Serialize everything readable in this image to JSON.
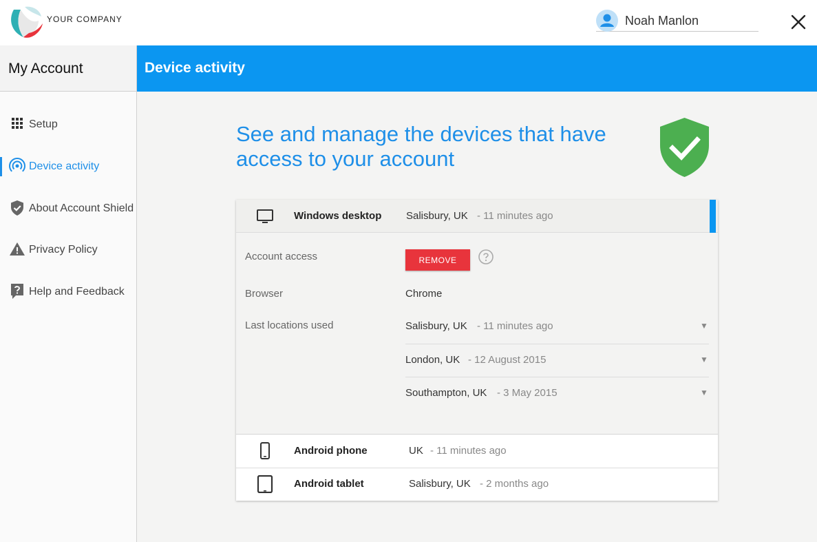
{
  "header": {
    "company_name": "YOUR COMPANY",
    "user_name": "Noah Manlon",
    "logo_icon": "company-logo",
    "close_icon": "close-icon"
  },
  "sidebar": {
    "title": "My Account",
    "items": [
      {
        "label": "Setup",
        "icon": "grid-icon"
      },
      {
        "label": "Device activity",
        "icon": "broadcast-icon",
        "active": true
      },
      {
        "label": "About Account Shield",
        "icon": "shield-check-icon"
      },
      {
        "label": "Privacy Policy",
        "icon": "warning-icon"
      },
      {
        "label": "Help and Feedback",
        "icon": "help-bubble-icon"
      }
    ]
  },
  "page": {
    "title": "Device activity",
    "headline": "See and manage the devices that have access to your account"
  },
  "devices": [
    {
      "name": "Windows desktop",
      "location": "Salisbury, UK",
      "time": "- 11 minutes ago",
      "icon": "monitor-icon",
      "expanded": true
    },
    {
      "name": "Android phone",
      "location": "UK",
      "time": "- 11 minutes ago",
      "icon": "phone-icon"
    },
    {
      "name": "Android tablet",
      "location": "Salisbury, UK",
      "time": "- 2 months ago",
      "icon": "tablet-icon"
    }
  ],
  "details": {
    "account_access_label": "Account access",
    "remove_label": "REMOVE",
    "browser_label": "Browser",
    "browser_value": "Chrome",
    "locations_label": "Last locations used",
    "locations": [
      {
        "place": "Salisbury, UK",
        "time": "- 11 minutes ago"
      },
      {
        "place": "London, UK",
        "time": "- 12 August 2015"
      },
      {
        "place": "Southampton, UK",
        "time": "- 3 May 2015"
      }
    ],
    "chevron": "▼"
  },
  "colors": {
    "accent_blue": "#0b96f1",
    "remove_red": "#e8343c",
    "shield_green": "#4caf50"
  }
}
